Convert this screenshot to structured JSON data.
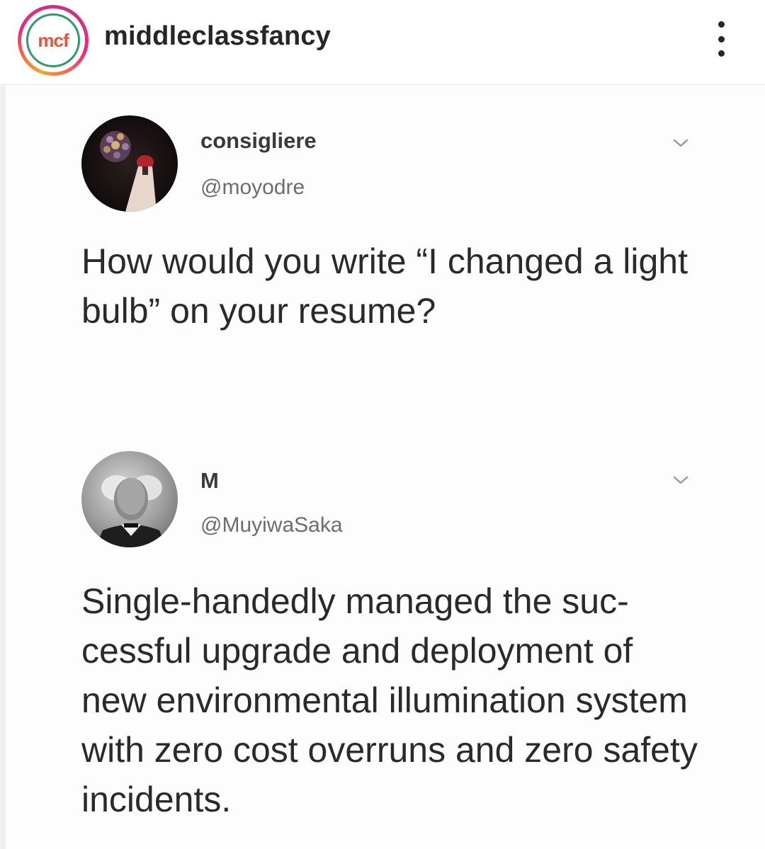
{
  "header": {
    "account_logo_text": "mcf",
    "username": "middleclassfancy",
    "more_icon": "more-vertical-icon"
  },
  "tweets": [
    {
      "name": "consigliere",
      "handle": "@moyodre",
      "text": "How would you write “I changed a light bulb” on your resume?",
      "menu_icon": "chevron-down-icon"
    },
    {
      "name": "M",
      "handle": "@MuyiwaSaka",
      "text": "Single-handedly managed the suc-cessful upgrade and deployment of new environmental illumination system with zero cost overruns and zero safety incidents.",
      "menu_icon": "chevron-down-icon"
    }
  ],
  "colors": {
    "logo_ring": "#2f9a6a",
    "logo_text": "#e4553a",
    "story_ring_start": "#f5a623",
    "story_ring_end": "#c13584"
  }
}
